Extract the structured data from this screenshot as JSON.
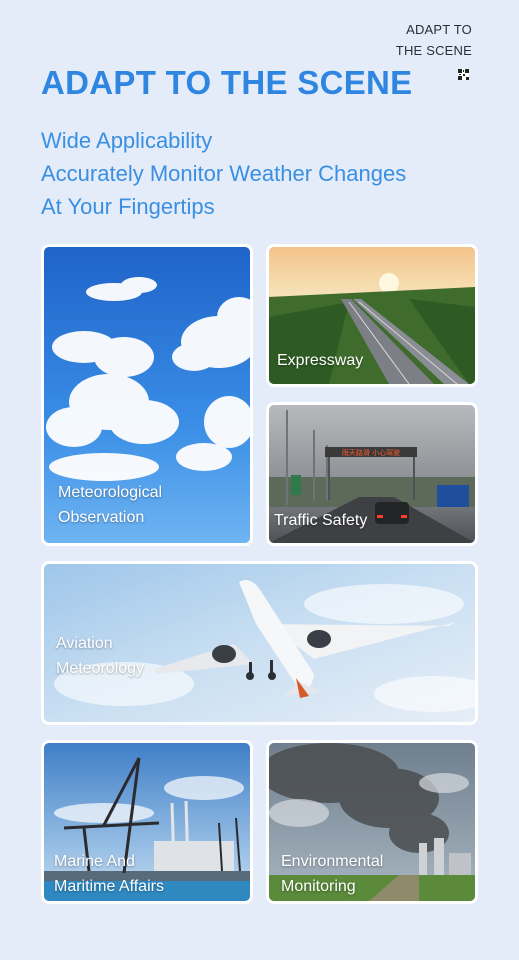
{
  "header": {
    "corner_label_line1": "ADAPT TO",
    "corner_label_line2": "THE SCENE",
    "corner_icon": "qr-code-icon",
    "title": "ADAPT TO THE SCENE",
    "subtitle_lines": [
      "Wide Applicability",
      "Accurately Monitor Weather Changes",
      "At Your Fingertips"
    ]
  },
  "cards": [
    {
      "id": "meteorological",
      "image": "sky-clouds-image",
      "label_line1": "Meteorological",
      "label_line2": "Observation"
    },
    {
      "id": "expressway",
      "image": "expressway-sunset-image",
      "label_line1": "Expressway"
    },
    {
      "id": "traffic",
      "image": "rainy-road-image",
      "label_line1": "Traffic Safety",
      "sign_text": "雨天路滑 小心驾驶"
    },
    {
      "id": "aviation",
      "image": "airplane-image",
      "label_line1": "Aviation",
      "label_line2": "Meteorology"
    },
    {
      "id": "marine",
      "image": "port-cranes-image",
      "label_line1": "Marine And",
      "label_line2": "Maritime Affairs"
    },
    {
      "id": "environment",
      "image": "smokestack-image",
      "label_line1": "Environmental",
      "label_line2": "Monitoring"
    }
  ],
  "colors": {
    "accent": "#2f86e0",
    "background": "#e3ecf8",
    "card_border": "#ffffff"
  }
}
